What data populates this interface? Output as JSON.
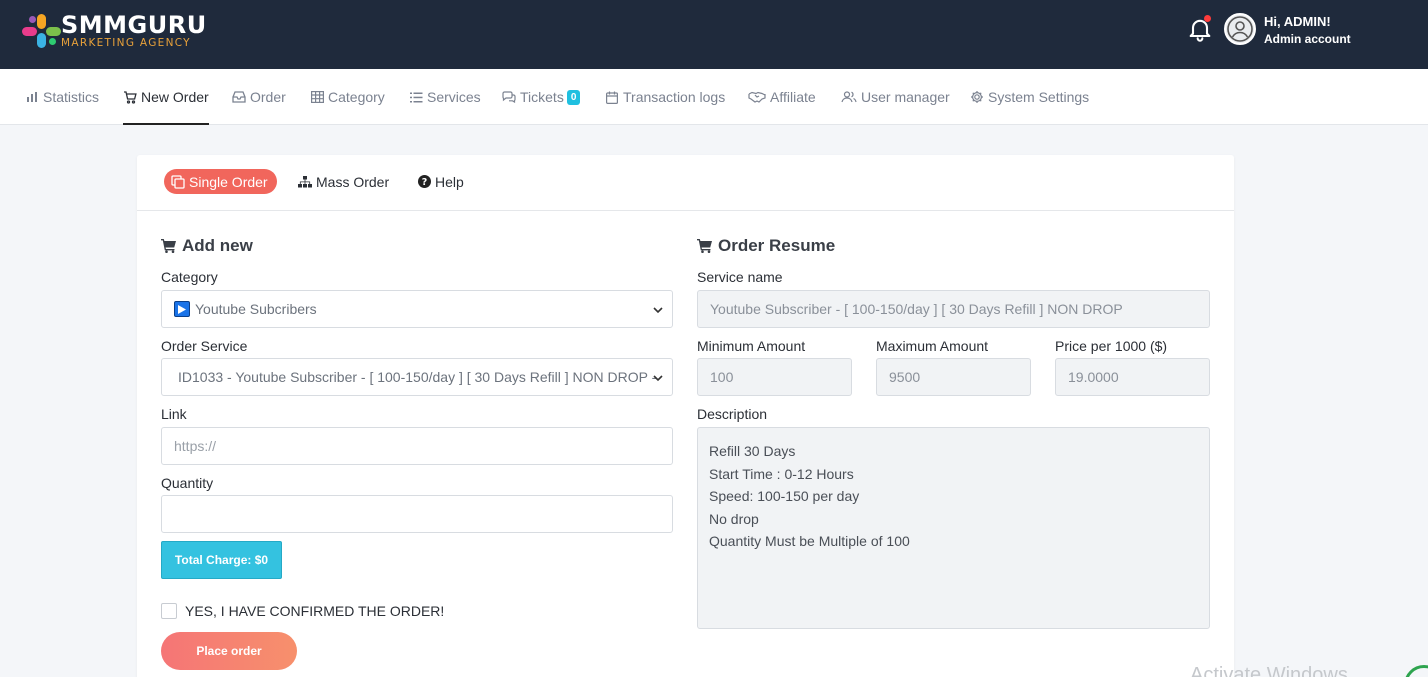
{
  "brand": {
    "name": "SMMGURU",
    "tagline": "MARKETING AGENCY"
  },
  "header": {
    "greeting": "Hi, ADMIN!",
    "role": "Admin account",
    "notification_dot_color": "#ff3b3b"
  },
  "nav": {
    "items": [
      {
        "label": "Statistics",
        "icon": "bar-chart-icon"
      },
      {
        "label": "New Order",
        "icon": "cart-icon",
        "active": true
      },
      {
        "label": "Order",
        "icon": "inbox-icon"
      },
      {
        "label": "Category",
        "icon": "table-icon"
      },
      {
        "label": "Services",
        "icon": "list-icon"
      },
      {
        "label": "Tickets",
        "icon": "chat-icon",
        "badge": "0"
      },
      {
        "label": "Transaction logs",
        "icon": "calendar-icon"
      },
      {
        "label": "Affiliate",
        "icon": "handshake-icon"
      },
      {
        "label": "User manager",
        "icon": "users-icon"
      },
      {
        "label": "System Settings",
        "icon": "gear-icon"
      }
    ]
  },
  "tabs": [
    {
      "label": "Single Order",
      "icon": "copy-icon",
      "active": true
    },
    {
      "label": "Mass Order",
      "icon": "sitemap-icon"
    },
    {
      "label": "Help",
      "icon": "question-icon"
    }
  ],
  "add_new": {
    "title": "Add new",
    "category_label": "Category",
    "category_value": "Youtube Subcribers",
    "service_label": "Order Service",
    "service_value": "ID1033 - Youtube Subscriber - [ 100-150/day ] [ 30 Days Refill ] NON DROP  -",
    "link_label": "Link",
    "link_placeholder": "https://",
    "link_value": "",
    "quantity_label": "Quantity",
    "quantity_value": "",
    "total_charge": "Total Charge: $0",
    "confirm_label": "YES, I HAVE CONFIRMED THE ORDER!",
    "confirm_checked": false,
    "place_order": "Place order"
  },
  "resume": {
    "title": "Order Resume",
    "service_name_label": "Service name",
    "service_name_value": "Youtube Subscriber - [ 100-150/day ] [ 30 Days Refill ] NON DROP",
    "min_label": "Minimum Amount",
    "min_value": "100",
    "max_label": "Maximum Amount",
    "max_value": "9500",
    "price_label": "Price per 1000 ($)",
    "price_value": "19.0000",
    "description_label": "Description",
    "description_lines": [
      "Refill 30 Days",
      "Start Time : 0-12 Hours",
      "Speed: 100-150 per day",
      "No drop",
      "Quantity Must be Multiple of 100"
    ]
  },
  "watermark": "Activate Windows",
  "colors": {
    "header_bg": "#1f2a3c",
    "accent": "#f1665c",
    "info": "#34c2e0",
    "badge": "#1fc0e0"
  }
}
